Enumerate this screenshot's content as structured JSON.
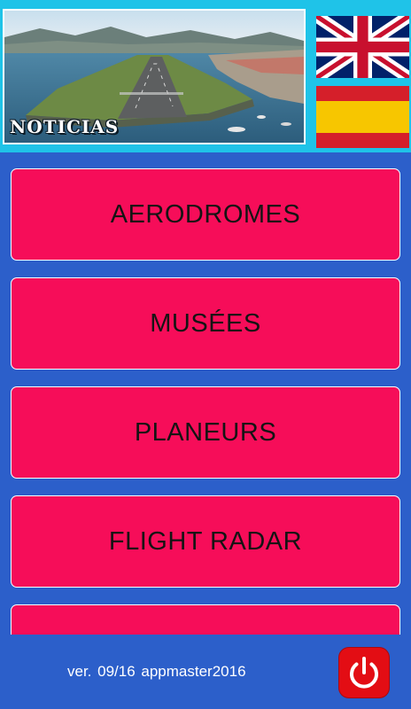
{
  "header": {
    "news_banner_label": "NOTICIAS",
    "flags": [
      {
        "name": "uk-flag",
        "language": "English"
      },
      {
        "name": "spain-flag",
        "language": "Español"
      }
    ]
  },
  "menu": {
    "items": [
      {
        "label": "AERODROMES"
      },
      {
        "label": "MUSÉES"
      },
      {
        "label": "PLANEURS"
      },
      {
        "label": "FLIGHT RADAR"
      },
      {
        "label": ""
      }
    ]
  },
  "footer": {
    "version_text": "ver. 09/16  appmaster2016",
    "power_icon": "power-icon"
  },
  "colors": {
    "background": "#2c5fca",
    "header": "#1fc3e8",
    "button": "#f60d59",
    "power_button": "#e30d14"
  }
}
